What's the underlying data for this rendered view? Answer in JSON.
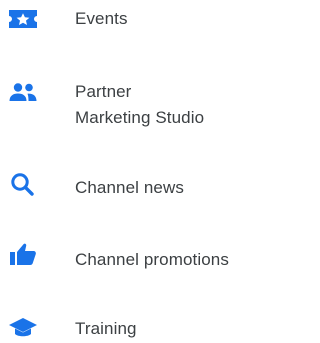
{
  "nav": {
    "items": [
      {
        "label": "Events",
        "icon": "star-ticket-icon"
      },
      {
        "label_line1": "Partner",
        "label_line2": "Marketing Studio",
        "icon": "people-icon"
      },
      {
        "label": "Channel news",
        "icon": "search-icon"
      },
      {
        "label": "Channel promotions",
        "icon": "thumbs-up-icon"
      },
      {
        "label": "Training",
        "icon": "graduation-cap-icon"
      }
    ]
  },
  "colors": {
    "icon_blue": "#1a73e8",
    "text": "#3c4043"
  }
}
